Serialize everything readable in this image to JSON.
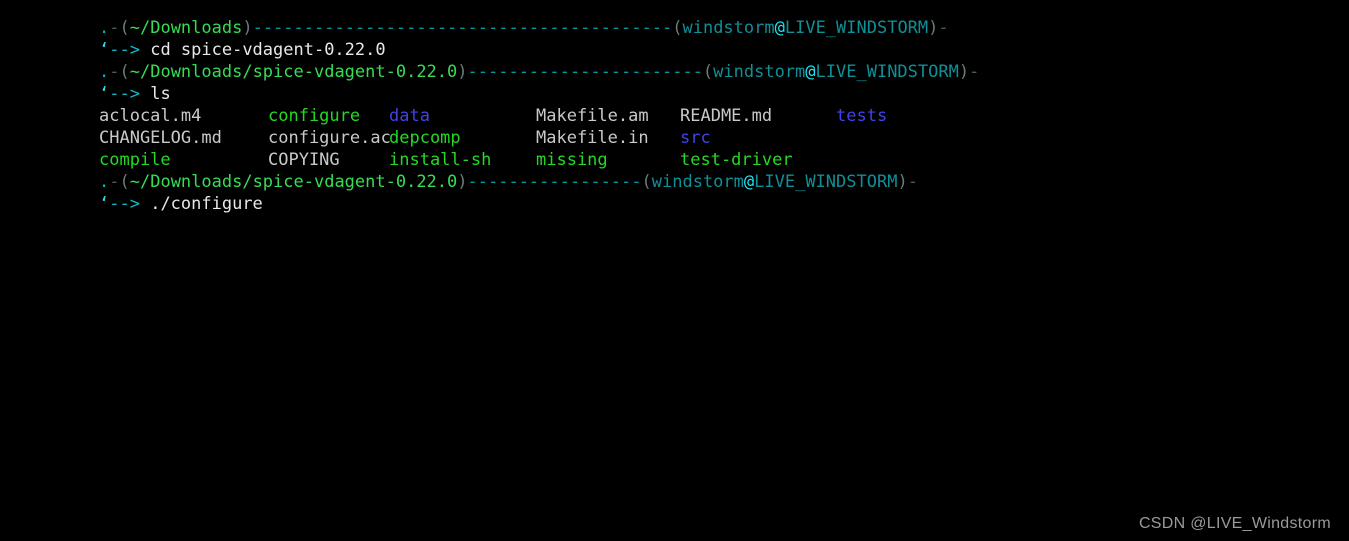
{
  "terminal": {
    "background": "#000000",
    "char_width": 12.07,
    "line_height": 22,
    "colors": {
      "file": "#c9c9c9",
      "executable": "#25d825",
      "directory": "#4242e6",
      "prompt_path": "#35dd55",
      "prompt_separator": "#009aa3",
      "prompt_user": "#0f8f97",
      "prompt_at": "#20e5f0",
      "command": "#e8e8e8"
    },
    "prompt": {
      "lead_dot": ".",
      "lead_dash": "-",
      "open_paren": "(",
      "close_paren": ")",
      "separator_char": "-",
      "user": "windstorm",
      "at": "@",
      "host": "LIVE_WINDSTORM",
      "tail_dash": "-",
      "continuation_tick": "‘",
      "continuation_arrow": "--> "
    },
    "blocks": [
      {
        "type": "prompt",
        "path": "~/Downloads",
        "separator": "-----------------------------------------",
        "command": "cd spice-vdagent-0.22.0"
      },
      {
        "type": "prompt",
        "path": "~/Downloads/spice-vdagent-0.22.0",
        "separator": "-----------------------",
        "command": "ls"
      },
      {
        "type": "ls_output",
        "columns_x": [
          0,
          169,
          290,
          437,
          581,
          737,
          894
        ],
        "rows": [
          [
            {
              "name": "aclocal.m4",
              "kind": "file"
            },
            {
              "name": "configure",
              "kind": "executable"
            },
            {
              "name": "data",
              "kind": "directory"
            },
            {
              "name": "Makefile.am",
              "kind": "file"
            },
            {
              "name": "README.md",
              "kind": "file"
            },
            {
              "name": "tests",
              "kind": "directory"
            }
          ],
          [
            {
              "name": "CHANGELOG.md",
              "kind": "file"
            },
            {
              "name": "configure.ac",
              "kind": "file"
            },
            {
              "name": "depcomp",
              "kind": "executable"
            },
            {
              "name": "Makefile.in",
              "kind": "file"
            },
            {
              "name": "src",
              "kind": "directory"
            }
          ],
          [
            {
              "name": "compile",
              "kind": "executable"
            },
            {
              "name": "COPYING",
              "kind": "file"
            },
            {
              "name": "install-sh",
              "kind": "executable"
            },
            {
              "name": "missing",
              "kind": "executable"
            },
            {
              "name": "test-driver",
              "kind": "executable"
            }
          ]
        ]
      },
      {
        "type": "prompt",
        "path": "~/Downloads/spice-vdagent-0.22.0",
        "separator": "-----------------",
        "command": "./configure"
      }
    ]
  },
  "watermark": {
    "text": "CSDN @LIVE_Windstorm"
  }
}
